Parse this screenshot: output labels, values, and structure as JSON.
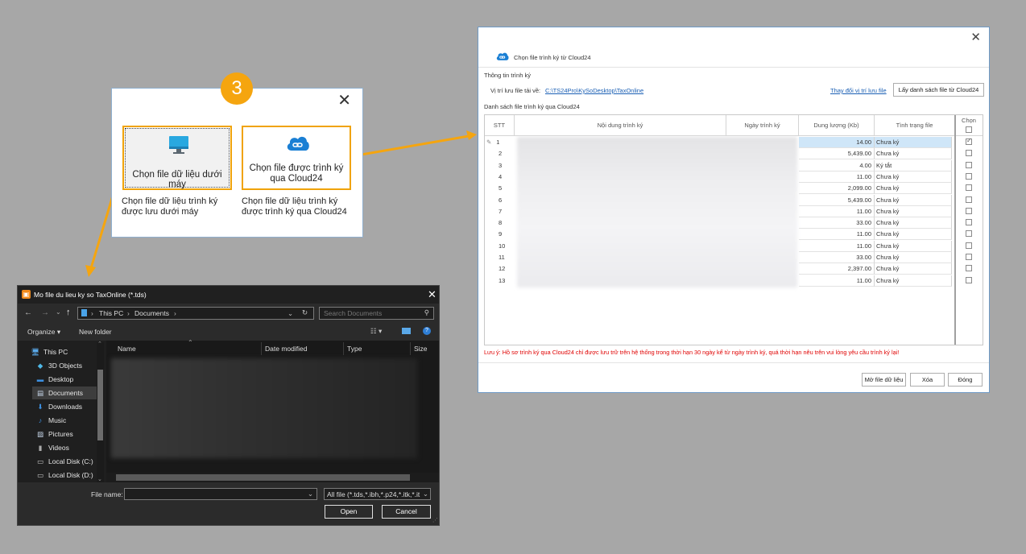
{
  "colors": {
    "accent": "#f5a50f",
    "link": "#1a5fb4",
    "warning": "#e00000",
    "cloud": "#1a7fd4"
  },
  "step_badge": "3",
  "chooser": {
    "close_icon": "close-icon",
    "option_local": {
      "label": "Chọn file dữ liệu dưới máy",
      "desc": "Chọn file dữ liệu trình ký được lưu dưới máy",
      "icon": "monitor-icon"
    },
    "option_cloud": {
      "label": "Chọn file được trình ký qua Cloud24",
      "desc": "Chọn file dữ liệu trình ký được trình ký qua Cloud24",
      "icon": "cloud-link-icon"
    }
  },
  "cloud_dialog": {
    "title": "Chọn file trình ký từ Cloud24",
    "section_info": "Thông tin trình ký",
    "path_label": "Vị trí lưu file tải về:",
    "path_value": "C:\\TS24Pro\\KySoDesktop\\TaxOnline",
    "change_path": "Thay đổi vị trí lưu file",
    "fetch_button": "Lấy danh sách file từ Cloud24",
    "list_label": "Danh sách file trình ký qua Cloud24",
    "columns": {
      "stt": "STT",
      "content": "Nội dung trình ký",
      "date": "Ngày trình ký",
      "size": "Dung lượng (Kb)",
      "status": "Tình trạng file",
      "select": "Chọn"
    },
    "rows": [
      {
        "stt": "1",
        "size": "14.00",
        "status": "Chưa ký",
        "checked": true
      },
      {
        "stt": "2",
        "size": "5,439.00",
        "status": "Chưa ký",
        "checked": false
      },
      {
        "stt": "3",
        "size": "4.00",
        "status": "Ký tắt",
        "checked": false
      },
      {
        "stt": "4",
        "size": "11.00",
        "status": "Chưa ký",
        "checked": false
      },
      {
        "stt": "5",
        "size": "2,099.00",
        "status": "Chưa ký",
        "checked": false
      },
      {
        "stt": "6",
        "size": "5,439.00",
        "status": "Chưa ký",
        "checked": false
      },
      {
        "stt": "7",
        "size": "11.00",
        "status": "Chưa ký",
        "checked": false
      },
      {
        "stt": "8",
        "size": "33.00",
        "status": "Chưa ký",
        "checked": false
      },
      {
        "stt": "9",
        "size": "11.00",
        "status": "Chưa ký",
        "checked": false
      },
      {
        "stt": "10",
        "size": "11.00",
        "status": "Chưa ký",
        "checked": false
      },
      {
        "stt": "11",
        "size": "33.00",
        "status": "Chưa ký",
        "checked": false
      },
      {
        "stt": "12",
        "size": "2,397.00",
        "status": "Chưa ký",
        "checked": false
      },
      {
        "stt": "13",
        "size": "11.00",
        "status": "Chưa ký",
        "checked": false
      }
    ],
    "note": "Lưu ý: Hồ sơ trình ký qua Cloud24 chỉ được lưu trữ trên hệ thống trong thời hạn 30 ngày kể từ ngày trình ký, quá thời hạn nêu trên vui lòng yêu cầu trình ký lại!",
    "buttons": {
      "open": "Mở file dữ liệu",
      "delete": "Xóa",
      "close": "Đóng"
    }
  },
  "file_dialog": {
    "title": "Mo file du lieu ky so TaxOnline (*.tds)",
    "breadcrumb": [
      "This PC",
      "Documents"
    ],
    "search_placeholder": "Search Documents",
    "organize": "Organize ▾",
    "new_folder": "New folder",
    "nav": [
      {
        "label": "This PC",
        "icon": "pc-icon"
      },
      {
        "label": "3D Objects",
        "icon": "cube-icon"
      },
      {
        "label": "Desktop",
        "icon": "desktop-icon"
      },
      {
        "label": "Documents",
        "icon": "document-icon",
        "selected": true
      },
      {
        "label": "Downloads",
        "icon": "download-icon"
      },
      {
        "label": "Music",
        "icon": "music-icon"
      },
      {
        "label": "Pictures",
        "icon": "picture-icon"
      },
      {
        "label": "Videos",
        "icon": "video-icon"
      },
      {
        "label": "Local Disk (C:)",
        "icon": "disk-icon"
      },
      {
        "label": "Local Disk (D:)",
        "icon": "disk-icon"
      }
    ],
    "columns": [
      "Name",
      "Date modified",
      "Type",
      "Size"
    ],
    "filename_label": "File name:",
    "filename_value": "",
    "filter": "All file (*.tds,*.ibh,*.p24,*.itk,*.it",
    "open": "Open",
    "cancel": "Cancel"
  }
}
